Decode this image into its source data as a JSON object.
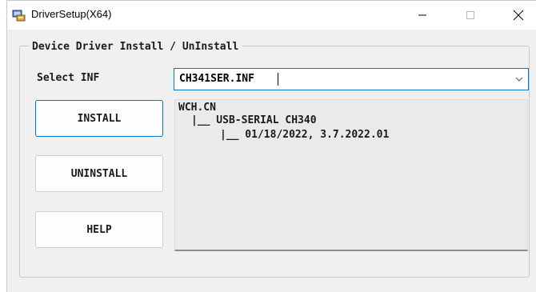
{
  "window": {
    "title": "DriverSetup(X64)",
    "icon": "driver-setup-icon"
  },
  "titlebar_buttons": {
    "minimize": "minimize-icon",
    "maximize": "maximize-icon",
    "close": "close-icon"
  },
  "group": {
    "legend": "Device Driver Install / UnInstall"
  },
  "select_inf": {
    "label": "Select INF",
    "value": "CH341SER.INF"
  },
  "buttons": {
    "install": "INSTALL",
    "uninstall": "UNINSTALL",
    "help": "HELP"
  },
  "driver_info": {
    "vendor": "WCH.CN",
    "device": "|__ USB-SERIAL CH340",
    "version": "|__ 01/18/2022, 3.7.2022.01"
  },
  "colors": {
    "accent": "#0078d7",
    "window_bg": "#f0f0f0"
  }
}
